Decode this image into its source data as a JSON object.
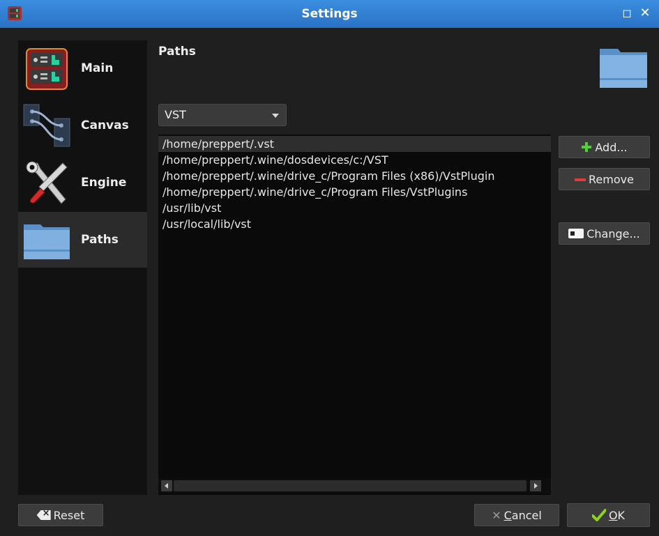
{
  "window": {
    "title": "Settings",
    "maximize_glyph": "◻",
    "close_glyph": "✕"
  },
  "sidebar": {
    "items": [
      {
        "label": "Main",
        "icon": "rack-icon",
        "active": false
      },
      {
        "label": "Canvas",
        "icon": "canvas-connections-icon",
        "active": false
      },
      {
        "label": "Engine",
        "icon": "tools-icon",
        "active": false
      },
      {
        "label": "Paths",
        "icon": "folder-icon",
        "active": true
      }
    ]
  },
  "content": {
    "section_title": "Paths",
    "plugin_type": {
      "selected": "VST"
    },
    "paths": [
      "/home/preppert/.vst",
      "/home/preppert/.wine/dosdevices/c:/VST",
      "/home/preppert/.wine/drive_c/Program Files (x86)/VstPlugin",
      "/home/preppert/.wine/drive_c/Program Files/VstPlugins",
      "/usr/lib/vst",
      "/usr/local/lib/vst"
    ],
    "selected_index": 0
  },
  "buttons": {
    "add": "Add...",
    "remove": "Remove",
    "change": "Change...",
    "reset": "Reset",
    "cancel_mnemonic": "C",
    "cancel_rest": "ancel",
    "ok_mnemonic": "O",
    "ok_rest": "K"
  },
  "colors": {
    "titlebar": "#2a72c4",
    "add_icon": "#4fcf3a",
    "remove_icon": "#e23b3b",
    "ok_check": "#8bd61c"
  }
}
